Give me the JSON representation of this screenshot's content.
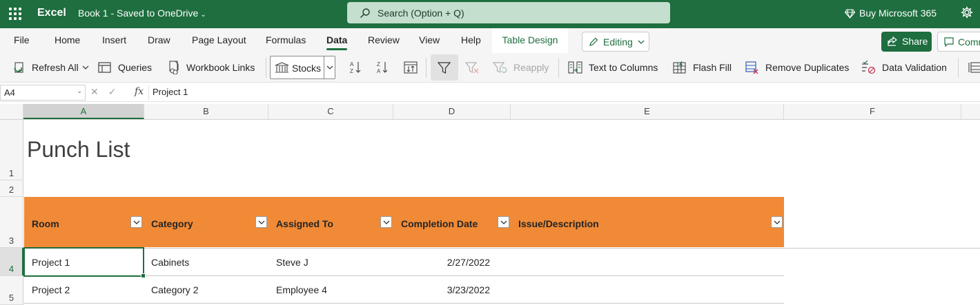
{
  "titlebar": {
    "app_name": "Excel",
    "doc_title": "Book 1  -  Saved to OneDrive",
    "search_placeholder": "Search (Option + Q)",
    "buy_label": "Buy Microsoft 365"
  },
  "tabs": [
    {
      "label": "File"
    },
    {
      "label": "Home"
    },
    {
      "label": "Insert"
    },
    {
      "label": "Draw"
    },
    {
      "label": "Page Layout"
    },
    {
      "label": "Formulas"
    },
    {
      "label": "Data",
      "active": true
    },
    {
      "label": "Review"
    },
    {
      "label": "View"
    },
    {
      "label": "Help"
    },
    {
      "label": "Table Design"
    }
  ],
  "ribbon_right": {
    "editing_label": "Editing",
    "share_label": "Share",
    "comments_label": "Comments"
  },
  "toolbar": {
    "refresh_all": "Refresh All",
    "queries": "Queries",
    "workbook_links": "Workbook Links",
    "stocks": "Stocks",
    "reapply": "Reapply",
    "text_to_columns": "Text to Columns",
    "flash_fill": "Flash Fill",
    "remove_duplicates": "Remove Duplicates",
    "data_validation": "Data Validation"
  },
  "formula_bar": {
    "name_box": "A4",
    "fx": "fx",
    "value": "Project 1"
  },
  "columns": [
    "A",
    "B",
    "C",
    "D",
    "E",
    "F"
  ],
  "rows": [
    "1",
    "2",
    "3",
    "4",
    "5"
  ],
  "sheet": {
    "title": "Punch List",
    "table_headers": [
      "Room",
      "Category",
      "Assigned To",
      "Completion Date",
      "Issue/Description"
    ],
    "table_rows": [
      [
        "Project 1",
        "Cabinets",
        "Steve J",
        "2/27/2022",
        ""
      ],
      [
        "Project 2",
        "Category 2",
        "Employee 4",
        "3/23/2022",
        ""
      ]
    ]
  },
  "colors": {
    "brand": "#1e6e3f",
    "table_header": "#f08a36"
  }
}
